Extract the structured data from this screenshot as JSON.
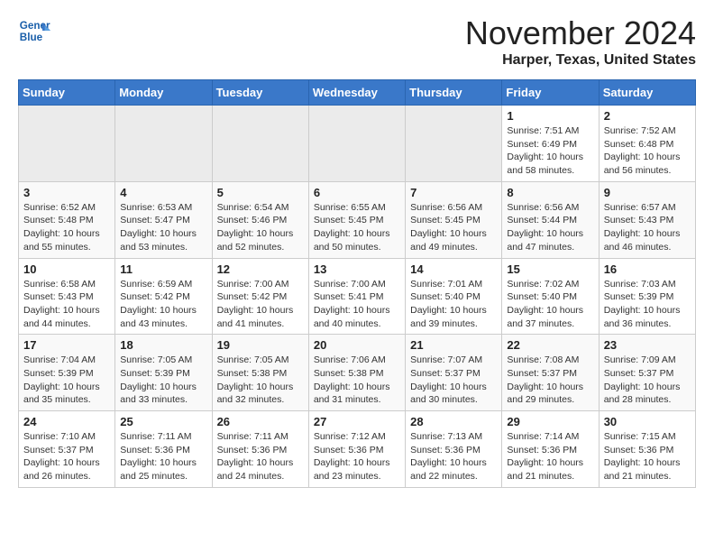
{
  "header": {
    "logo_line1": "General",
    "logo_line2": "Blue",
    "month": "November 2024",
    "location": "Harper, Texas, United States"
  },
  "days_of_week": [
    "Sunday",
    "Monday",
    "Tuesday",
    "Wednesday",
    "Thursday",
    "Friday",
    "Saturday"
  ],
  "weeks": [
    [
      {
        "day": "",
        "info": ""
      },
      {
        "day": "",
        "info": ""
      },
      {
        "day": "",
        "info": ""
      },
      {
        "day": "",
        "info": ""
      },
      {
        "day": "",
        "info": ""
      },
      {
        "day": "1",
        "info": "Sunrise: 7:51 AM\nSunset: 6:49 PM\nDaylight: 10 hours and 58 minutes."
      },
      {
        "day": "2",
        "info": "Sunrise: 7:52 AM\nSunset: 6:48 PM\nDaylight: 10 hours and 56 minutes."
      }
    ],
    [
      {
        "day": "3",
        "info": "Sunrise: 6:52 AM\nSunset: 5:48 PM\nDaylight: 10 hours and 55 minutes."
      },
      {
        "day": "4",
        "info": "Sunrise: 6:53 AM\nSunset: 5:47 PM\nDaylight: 10 hours and 53 minutes."
      },
      {
        "day": "5",
        "info": "Sunrise: 6:54 AM\nSunset: 5:46 PM\nDaylight: 10 hours and 52 minutes."
      },
      {
        "day": "6",
        "info": "Sunrise: 6:55 AM\nSunset: 5:45 PM\nDaylight: 10 hours and 50 minutes."
      },
      {
        "day": "7",
        "info": "Sunrise: 6:56 AM\nSunset: 5:45 PM\nDaylight: 10 hours and 49 minutes."
      },
      {
        "day": "8",
        "info": "Sunrise: 6:56 AM\nSunset: 5:44 PM\nDaylight: 10 hours and 47 minutes."
      },
      {
        "day": "9",
        "info": "Sunrise: 6:57 AM\nSunset: 5:43 PM\nDaylight: 10 hours and 46 minutes."
      }
    ],
    [
      {
        "day": "10",
        "info": "Sunrise: 6:58 AM\nSunset: 5:43 PM\nDaylight: 10 hours and 44 minutes."
      },
      {
        "day": "11",
        "info": "Sunrise: 6:59 AM\nSunset: 5:42 PM\nDaylight: 10 hours and 43 minutes."
      },
      {
        "day": "12",
        "info": "Sunrise: 7:00 AM\nSunset: 5:42 PM\nDaylight: 10 hours and 41 minutes."
      },
      {
        "day": "13",
        "info": "Sunrise: 7:00 AM\nSunset: 5:41 PM\nDaylight: 10 hours and 40 minutes."
      },
      {
        "day": "14",
        "info": "Sunrise: 7:01 AM\nSunset: 5:40 PM\nDaylight: 10 hours and 39 minutes."
      },
      {
        "day": "15",
        "info": "Sunrise: 7:02 AM\nSunset: 5:40 PM\nDaylight: 10 hours and 37 minutes."
      },
      {
        "day": "16",
        "info": "Sunrise: 7:03 AM\nSunset: 5:39 PM\nDaylight: 10 hours and 36 minutes."
      }
    ],
    [
      {
        "day": "17",
        "info": "Sunrise: 7:04 AM\nSunset: 5:39 PM\nDaylight: 10 hours and 35 minutes."
      },
      {
        "day": "18",
        "info": "Sunrise: 7:05 AM\nSunset: 5:39 PM\nDaylight: 10 hours and 33 minutes."
      },
      {
        "day": "19",
        "info": "Sunrise: 7:05 AM\nSunset: 5:38 PM\nDaylight: 10 hours and 32 minutes."
      },
      {
        "day": "20",
        "info": "Sunrise: 7:06 AM\nSunset: 5:38 PM\nDaylight: 10 hours and 31 minutes."
      },
      {
        "day": "21",
        "info": "Sunrise: 7:07 AM\nSunset: 5:37 PM\nDaylight: 10 hours and 30 minutes."
      },
      {
        "day": "22",
        "info": "Sunrise: 7:08 AM\nSunset: 5:37 PM\nDaylight: 10 hours and 29 minutes."
      },
      {
        "day": "23",
        "info": "Sunrise: 7:09 AM\nSunset: 5:37 PM\nDaylight: 10 hours and 28 minutes."
      }
    ],
    [
      {
        "day": "24",
        "info": "Sunrise: 7:10 AM\nSunset: 5:37 PM\nDaylight: 10 hours and 26 minutes."
      },
      {
        "day": "25",
        "info": "Sunrise: 7:11 AM\nSunset: 5:36 PM\nDaylight: 10 hours and 25 minutes."
      },
      {
        "day": "26",
        "info": "Sunrise: 7:11 AM\nSunset: 5:36 PM\nDaylight: 10 hours and 24 minutes."
      },
      {
        "day": "27",
        "info": "Sunrise: 7:12 AM\nSunset: 5:36 PM\nDaylight: 10 hours and 23 minutes."
      },
      {
        "day": "28",
        "info": "Sunrise: 7:13 AM\nSunset: 5:36 PM\nDaylight: 10 hours and 22 minutes."
      },
      {
        "day": "29",
        "info": "Sunrise: 7:14 AM\nSunset: 5:36 PM\nDaylight: 10 hours and 21 minutes."
      },
      {
        "day": "30",
        "info": "Sunrise: 7:15 AM\nSunset: 5:36 PM\nDaylight: 10 hours and 21 minutes."
      }
    ]
  ]
}
